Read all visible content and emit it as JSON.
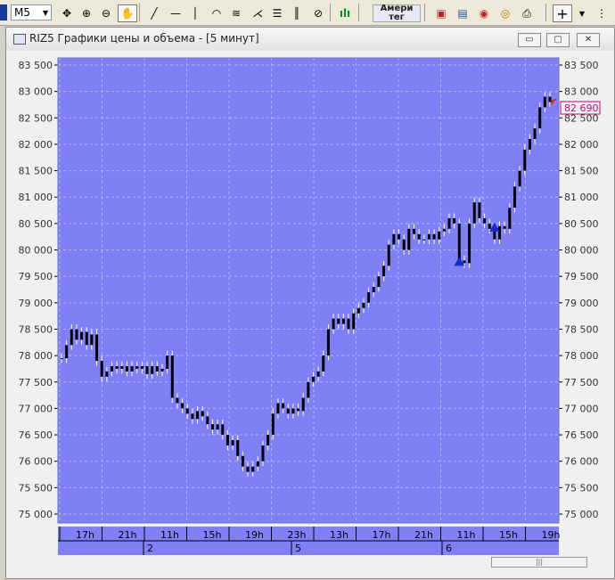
{
  "toolbar": {
    "timeframe": "M5",
    "news_line1": "Амери",
    "news_line2": "тег",
    "add_symbol": "+"
  },
  "window": {
    "title": "RIZ5 Графики цены и объема - [5 минут]",
    "min_label": "▭",
    "max_label": "▢",
    "close_label": "✕",
    "scroll_thumb": "|||"
  },
  "colors": {
    "plot_bg": "#8080f6",
    "grid": "#b4b4ff",
    "candle": "#000000",
    "wick": "#ffffff",
    "price_marker": "#cc0066",
    "arrow_buy": "#1a2ac8",
    "arrow_sell": "#e0202a"
  },
  "chart_data": {
    "type": "line",
    "title": "",
    "ylim": [
      75000,
      83500
    ],
    "y_ticks": [
      "75 000",
      "75 500",
      "76 000",
      "76 500",
      "77 000",
      "77 500",
      "78 000",
      "78 500",
      "79 000",
      "79 500",
      "80 000",
      "80 500",
      "81 000",
      "81 500",
      "82 000",
      "82 500",
      "83 000",
      "83 500"
    ],
    "x_ticks": [
      "17h",
      "21h",
      "11h",
      "15h",
      "19h",
      "23h",
      "13h",
      "17h",
      "21h",
      "11h",
      "15h",
      "19h"
    ],
    "day_labels": [
      "2",
      "5",
      "6"
    ],
    "last_price": "82 690",
    "series": [
      {
        "values": [
          77950,
          78200,
          78500,
          78300,
          78450,
          78200,
          78400,
          77900,
          77600,
          77700,
          77800,
          77750,
          77800,
          77700,
          77800,
          77750,
          77800,
          77650,
          77800,
          77700,
          77750,
          78000,
          77200,
          77100,
          77000,
          76900,
          76800,
          76950,
          76850,
          76700,
          76600,
          76700,
          76500,
          76300,
          76400,
          76100,
          75900,
          75800,
          75900,
          76000,
          76300,
          76500,
          76900,
          77100,
          77000,
          76900,
          77000,
          76950,
          77200,
          77500,
          77600,
          77700,
          78000,
          78500,
          78700,
          78600,
          78700,
          78500,
          78800,
          78900,
          79000,
          79200,
          79300,
          79500,
          79700,
          80100,
          80300,
          80200,
          80000,
          80400,
          80300,
          80200,
          80200,
          80300,
          80200,
          80350,
          80400,
          80600,
          80500,
          79800,
          79750,
          80500,
          80900,
          80600,
          80500,
          80400,
          80200,
          80450,
          80400,
          80800,
          81200,
          81500,
          81900,
          82100,
          82300,
          82700,
          82900,
          82800
        ]
      }
    ],
    "markers": [
      {
        "type": "buy",
        "index": 79,
        "price": 79800
      },
      {
        "type": "buy",
        "index": 86,
        "price": 80450
      },
      {
        "type": "sell",
        "index": 97,
        "price": 82800
      }
    ]
  }
}
